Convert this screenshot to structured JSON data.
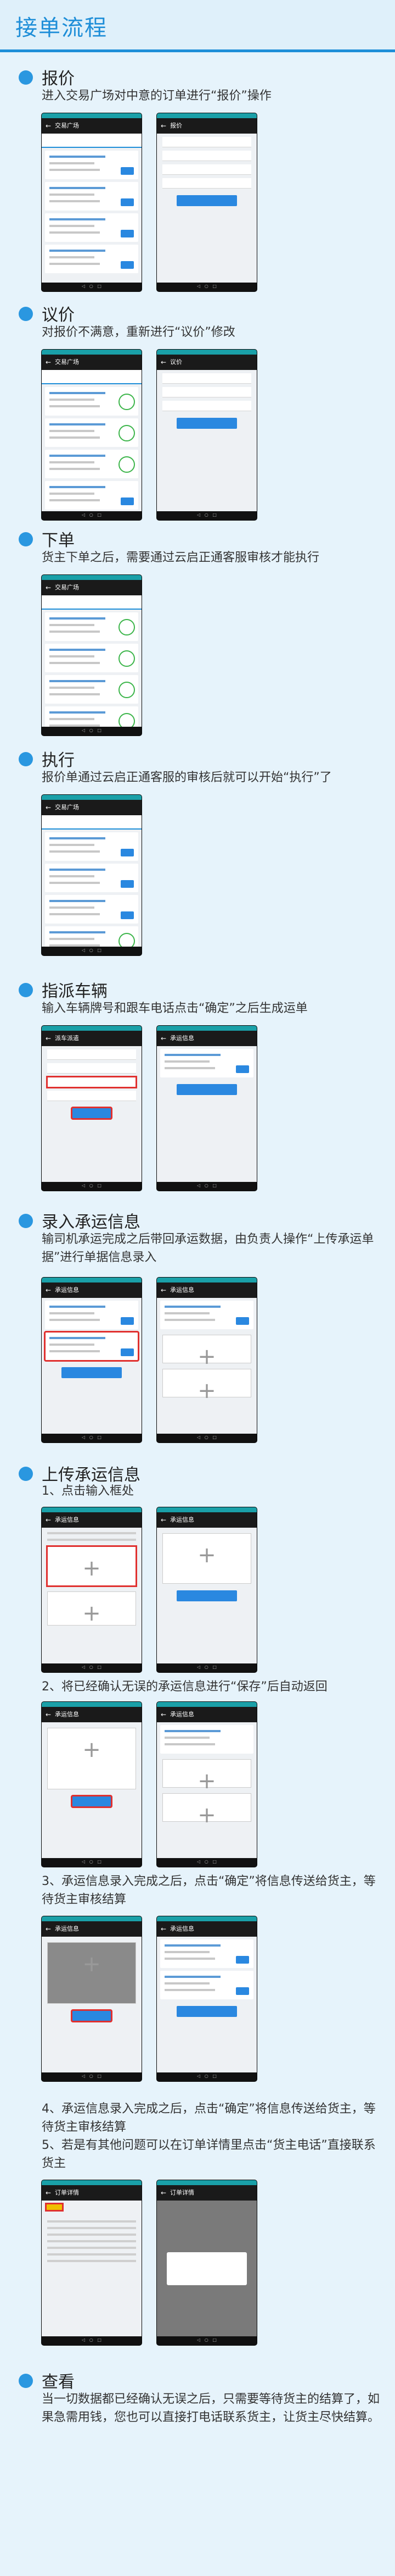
{
  "header": {
    "title": "接单流程"
  },
  "sections": [
    {
      "title": "报价",
      "desc": "进入交易广场对中意的订单进行“报价”操作"
    },
    {
      "title": "议价",
      "desc": "对报价不满意，重新进行“议价”修改"
    },
    {
      "title": "下单",
      "desc": "货主下单之后，需要通过云启正通客服审核才能执行"
    },
    {
      "title": "执行",
      "desc": "报价单通过云启正通客服的审核后就可以开始“执行”了"
    },
    {
      "title": "指派车辆",
      "desc": "输入车辆牌号和跟车电话点击“确定”之后生成运单"
    },
    {
      "title": "录入承运信息",
      "desc": "输司机承运完成之后带回承运数据，由负责人操作“上传承运单据”进行单据信息录入"
    },
    {
      "title": "上传承运信息",
      "desc": "1、点击输入框处",
      "step2": "2、将已经确认无误的承运信息进行“保存”后自动返回",
      "step3": "3、承运信息录入完成之后，点击“确定”将信息传送给货主，等待货主审核结算",
      "step4": "4、承运信息录入完成之后，点击“确定”将信息传送给货主，等待货主审核结算",
      "step5": "5、若是有其他问题可以在订单详情里点击“货主电话”直接联系货主"
    },
    {
      "title": "查看",
      "desc": "当一切数据都已经确认无误之后，只需要等待货主的结算了，如果急需用钱，您也可以直接打电话联系货主，让货主尽快结算。"
    }
  ],
  "colors": {
    "accent": "#1e8ed8",
    "background": "#e6f3fb",
    "highlight": "#e0302f"
  }
}
